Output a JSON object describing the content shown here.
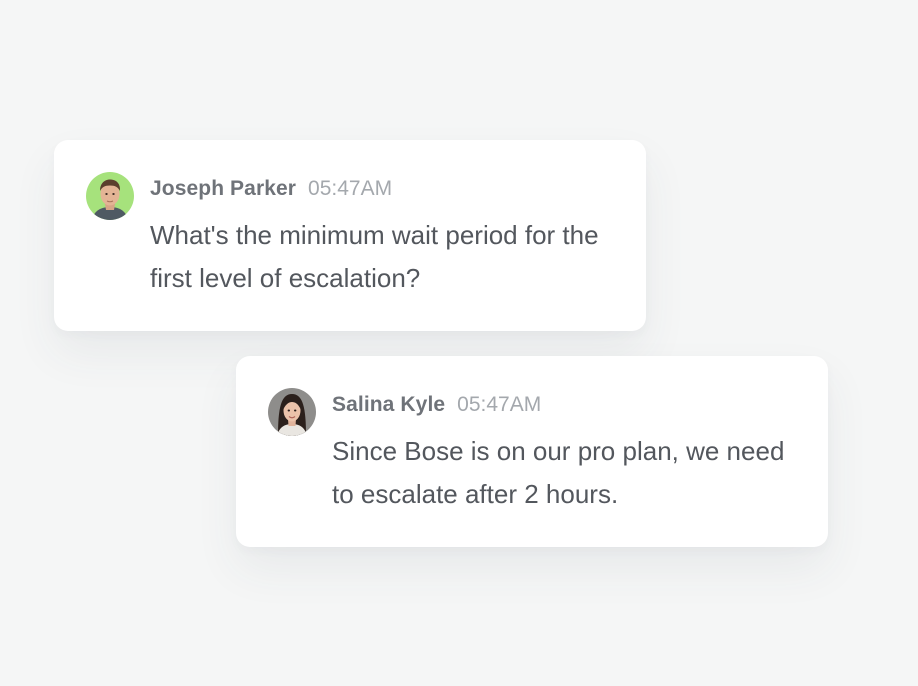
{
  "messages": [
    {
      "author": "Joseph Parker",
      "time": "05:47AM",
      "text": "What's the minimum wait period for the first level of escalation?",
      "avatar_bg": "#a6e27c"
    },
    {
      "author": "Salina Kyle",
      "time": "05:47AM",
      "text": "Since Bose is on our pro plan, we need to escalate after 2 hours.",
      "avatar_bg": "#8e8d8b"
    }
  ]
}
